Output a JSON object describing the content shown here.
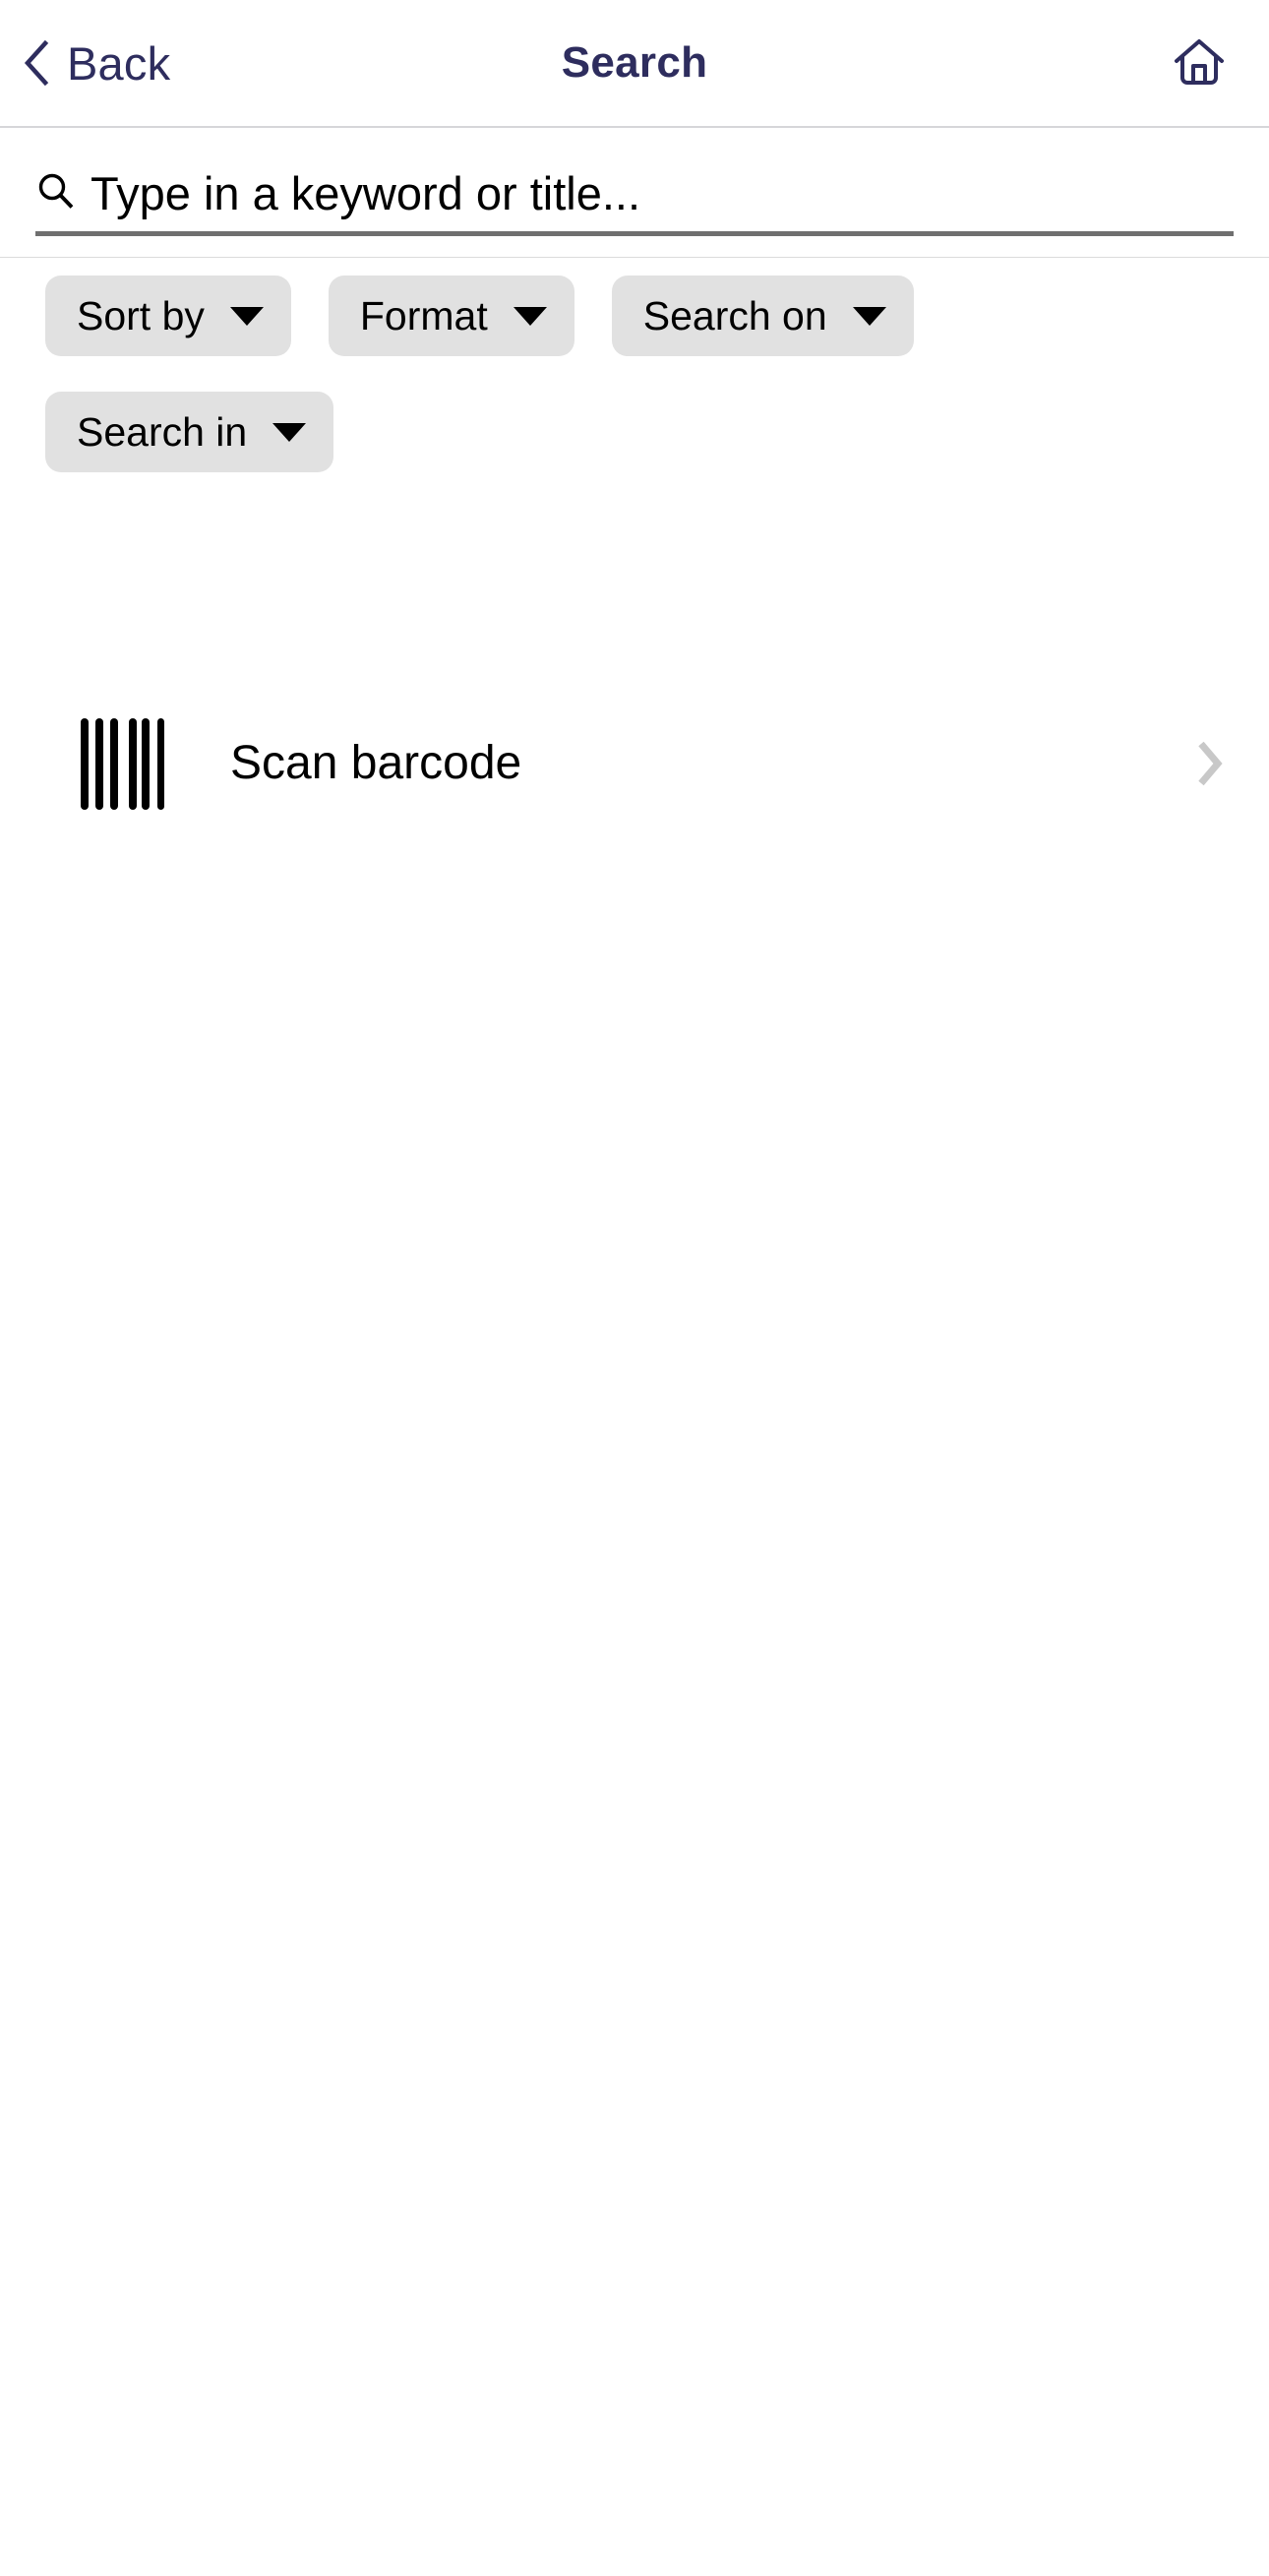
{
  "header": {
    "back_label": "Back",
    "title": "Search",
    "back_icon": "chevron-left-icon",
    "home_icon": "home-icon"
  },
  "search": {
    "icon": "search-icon",
    "placeholder": "Type in a keyword or title...",
    "value": ""
  },
  "filters": [
    {
      "label": "Sort by",
      "icon": "chevron-down-icon"
    },
    {
      "label": "Format",
      "icon": "chevron-down-icon"
    },
    {
      "label": "Search on",
      "icon": "chevron-down-icon"
    },
    {
      "label": "Search in",
      "icon": "chevron-down-icon"
    }
  ],
  "actions": [
    {
      "label": "Scan barcode",
      "leading_icon": "barcode-icon",
      "trailing_icon": "chevron-right-icon"
    }
  ],
  "colors": {
    "brand_navy": "#2e2d5e",
    "chip_bg": "#e1e1e1",
    "text": "#000000",
    "divider": "#dcdcdc",
    "underline": "#6f6f6f",
    "chevron_gray": "#c8c8c8"
  }
}
